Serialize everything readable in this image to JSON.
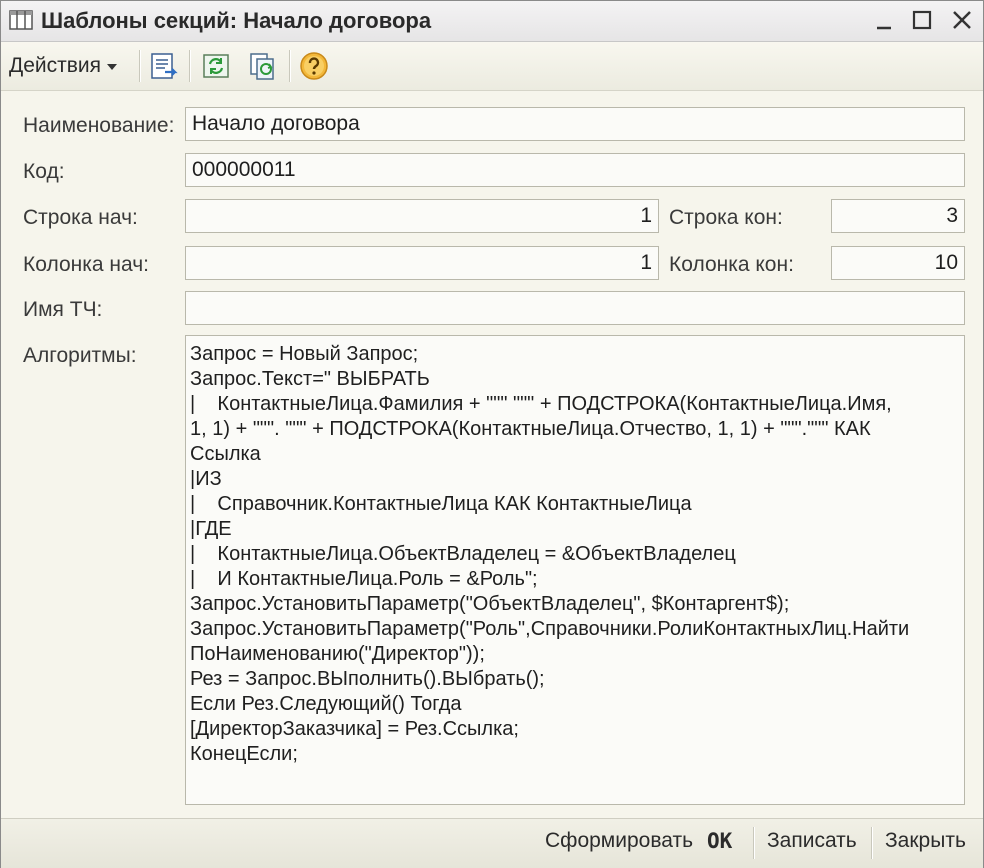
{
  "window": {
    "title": "Шаблоны секций: Начало договора",
    "icon": "table-columns-icon"
  },
  "toolbar": {
    "actions_label": "Действия",
    "icons": [
      "save-and-close-icon",
      "refresh-icon",
      "copy-icon",
      "help-icon"
    ]
  },
  "form": {
    "name_label": "Наименование:",
    "name_value": "Начало договора",
    "code_label": "Код:",
    "code_value": "000000011",
    "row_start_label": "Строка нач:",
    "row_start_value": "1",
    "row_end_label": "Строка кон:",
    "row_end_value": "3",
    "col_start_label": "Колонка нач:",
    "col_start_value": "1",
    "col_end_label": "Колонка кон:",
    "col_end_value": "10",
    "tch_label": "Имя ТЧ:",
    "tch_value": "",
    "algo_label": "Алгоритмы:",
    "algo_lines": [
      "Запрос = Новый Запрос;",
      "Запрос.Текст=\" ВЫБРАТЬ",
      "|    КонтактныеЛица.Фамилия + \"\"\" \"\"\" + ПОДСТРОКА(КонтактныеЛица.Имя,",
      "1, 1) + \"\"\". \"\"\" + ПОДСТРОКА(КонтактныеЛица.Отчество, 1, 1) + \"\"\".\"\"\" КАК",
      "Ссылка",
      "|ИЗ",
      "|    Справочник.КонтактныеЛица КАК КонтактныеЛица",
      "|ГДЕ",
      "|    КонтактныеЛица.ОбъектВладелец = &ОбъектВладелец",
      "|    И КонтактныеЛица.Роль = &Роль\";",
      "Запрос.УстановитьПараметр(\"ОбъектВладелец\", $Контаргент$);",
      "Запрос.УстановитьПараметр(\"Роль\",Справочники.РолиКонтактныхЛиц.Найти",
      "ПоНаименованию(\"Директор\"));",
      "Рез = Запрос.ВЫполнить().ВЫбрать();",
      "Если Рез.Следующий() Тогда",
      "[ДиректорЗаказчика] = Рез.Ссылка;",
      "КонецЕсли;"
    ]
  },
  "bottom": {
    "generate": "Сформировать",
    "ok": "OK",
    "save": "Записать",
    "close": "Закрыть"
  }
}
